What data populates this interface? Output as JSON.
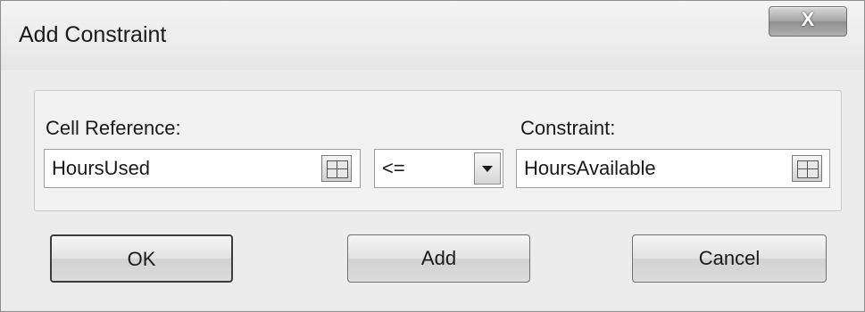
{
  "dialog": {
    "title": "Add Constraint",
    "close_label": "X"
  },
  "fields": {
    "cell_reference_label": "Cell Reference:",
    "cell_reference_value": "HoursUsed",
    "operator_value": "<=",
    "constraint_label": "Constraint:",
    "constraint_value": "HoursAvailable"
  },
  "buttons": {
    "ok_label": "OK",
    "add_label": "Add",
    "cancel_label": "Cancel"
  },
  "icons": {
    "ref_edit": "range-selector-icon",
    "dropdown": "chevron-down-icon"
  }
}
